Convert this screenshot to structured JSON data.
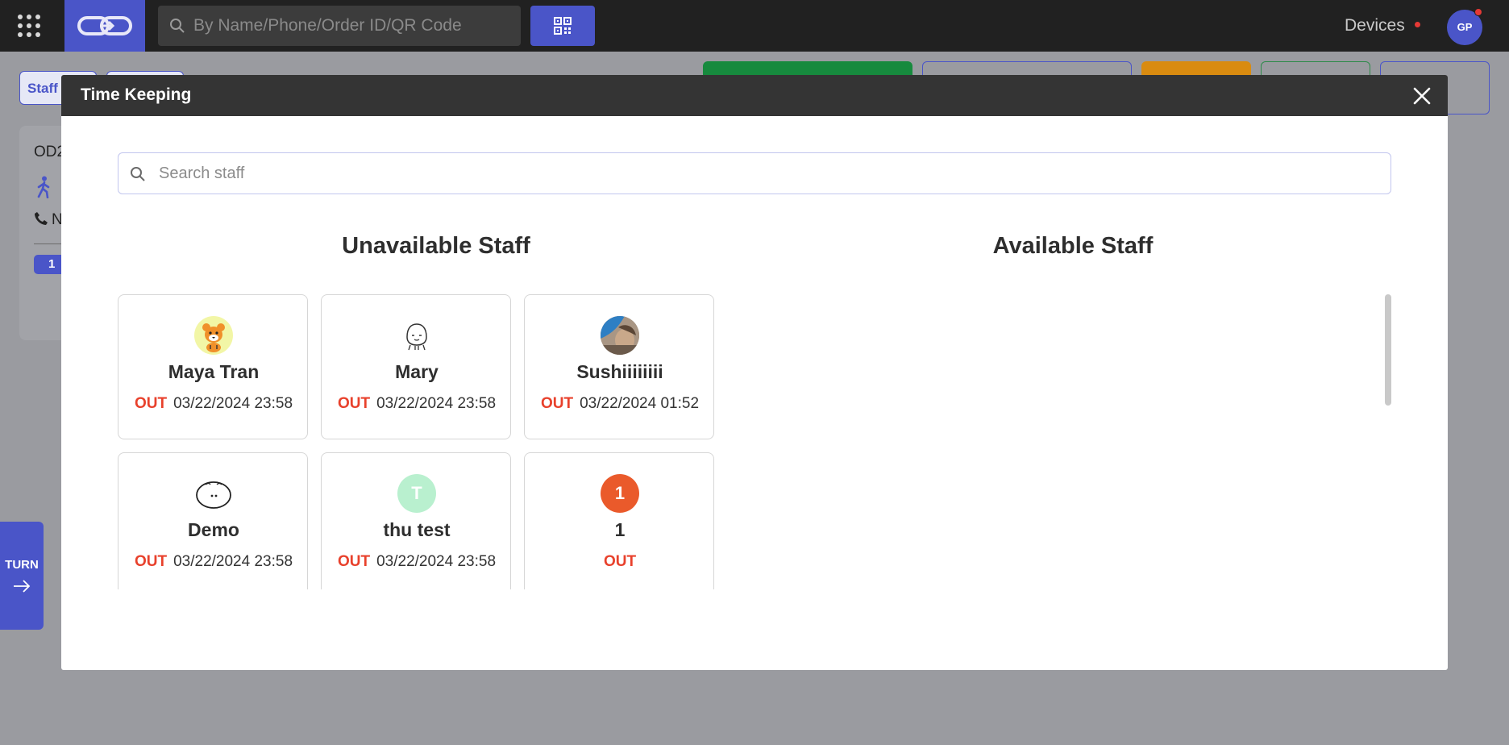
{
  "topbar": {
    "search_placeholder": "By Name/Phone/Order ID/QR Code",
    "devices_label": "Devices",
    "user_initials": "GP",
    "brand_color": "#4a55c8"
  },
  "background": {
    "staff_tab_label": "Staff",
    "order_id_partial": "OD2",
    "phone_partial": "N",
    "badge_count": "1",
    "turn_label": "TURN"
  },
  "modal": {
    "title": "Time Keeping",
    "search_placeholder": "Search staff",
    "unavailable_heading": "Unavailable Staff",
    "available_heading": "Available Staff",
    "unavailable_staff": [
      {
        "name": "Maya Tran",
        "status": "OUT",
        "time": "03/22/2024 23:58",
        "avatar": "tiger-cartoon-avatar"
      },
      {
        "name": "Mary",
        "status": "OUT",
        "time": "03/22/2024 23:58",
        "avatar": "ghost-cartoon-avatar"
      },
      {
        "name": "Sushiiiiiiii",
        "status": "OUT",
        "time": "03/22/2024 01:52",
        "avatar": "photo-avatar"
      },
      {
        "name": "Demo",
        "status": "OUT",
        "time": "03/22/2024 23:58",
        "avatar": "blob-cartoon-avatar"
      },
      {
        "name": "thu test",
        "status": "OUT",
        "time": "03/22/2024 23:58",
        "avatar_initial": "T",
        "avatar_color": "#b9f0cf"
      },
      {
        "name": "1",
        "status": "OUT",
        "time": "",
        "avatar_initial": "1",
        "avatar_color": "#ea5a2b"
      }
    ],
    "available_staff": [],
    "status_color": "#e8412c"
  }
}
